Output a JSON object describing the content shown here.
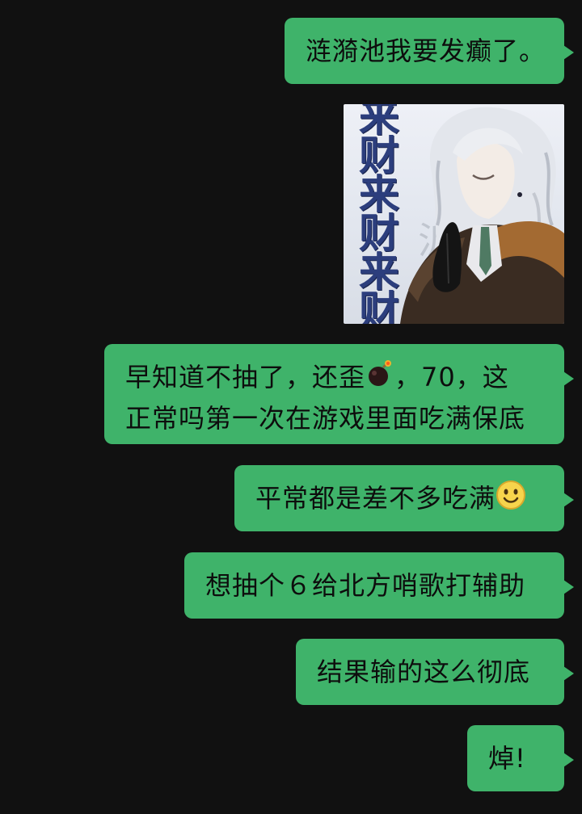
{
  "messages": [
    {
      "id": "m1",
      "lines": [
        "涟漪池我要发癫了。"
      ]
    },
    {
      "id": "m2",
      "type": "sticker",
      "text": [
        "来",
        "财",
        "来",
        "财",
        "来",
        "财"
      ]
    },
    {
      "id": "m3",
      "lines": [
        "早知道不抽了，还歪",
        "，70，这",
        "正常吗第一次在游戏里面吃满保底"
      ]
    },
    {
      "id": "m4",
      "lines": [
        "平常都是差不多吃满"
      ]
    },
    {
      "id": "m5",
      "lines": [
        "想抽个６给北方哨歌打辅助"
      ]
    },
    {
      "id": "m6",
      "lines": [
        "结果输的这么彻底"
      ]
    },
    {
      "id": "m7",
      "lines": [
        "焯!"
      ]
    }
  ],
  "icons": {
    "bomb": "bomb-icon",
    "smile": "smile-emoji-icon"
  },
  "colors": {
    "background": "#111111",
    "bubble": "#3fb36a",
    "text": "#0d0d0d"
  }
}
